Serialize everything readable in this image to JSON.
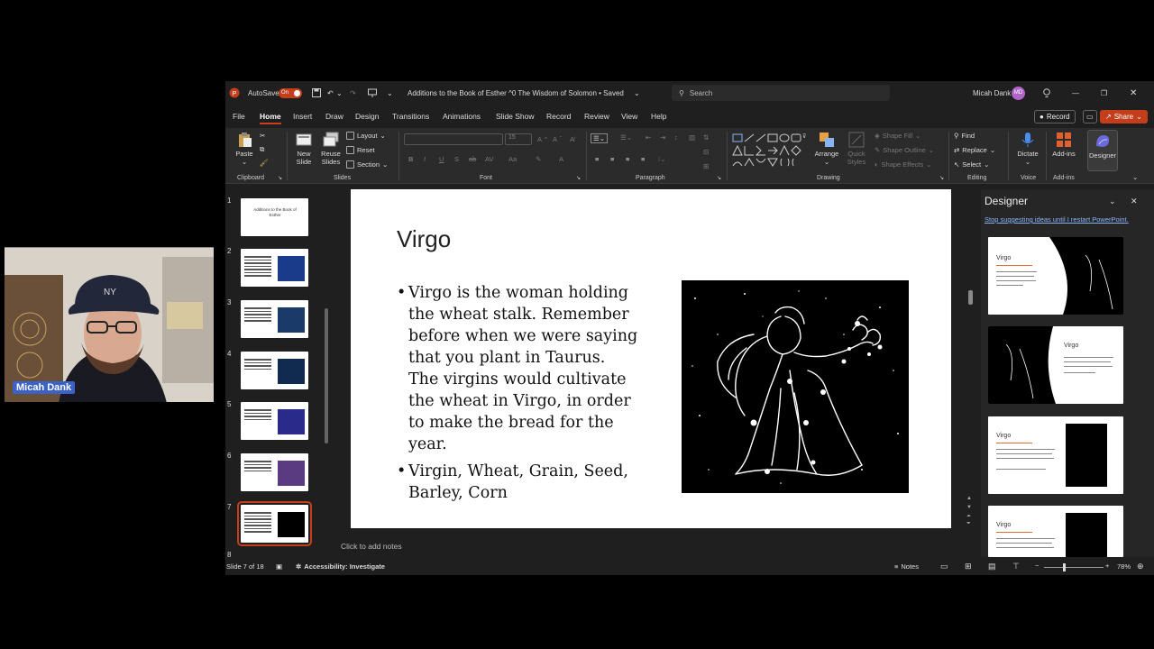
{
  "titlebar": {
    "autosave_label": "AutoSave",
    "autosave_state": "On",
    "doc_title": "Additions to the Book of Esther ^0 The Wisdom of Solomon • Saved",
    "search_placeholder": "Search",
    "user_name": "Micah Dank",
    "user_initials": "MD"
  },
  "menu": {
    "items": [
      "File",
      "Home",
      "Insert",
      "Draw",
      "Design",
      "Transitions",
      "Animations",
      "Slide Show",
      "Record",
      "Review",
      "View",
      "Help"
    ],
    "active": "Home",
    "record_button": "Record",
    "share_button": "Share"
  },
  "ribbon": {
    "clipboard": {
      "paste": "Paste",
      "label": "Clipboard"
    },
    "slides": {
      "new_slide": "New Slide",
      "reuse_slides": "Reuse Slides",
      "layout": "Layout",
      "reset": "Reset",
      "section": "Section",
      "label": "Slides"
    },
    "font": {
      "size": "15",
      "label": "Font"
    },
    "paragraph": {
      "label": "Paragraph"
    },
    "drawing": {
      "arrange": "Arrange",
      "quick_styles": "Quick Styles",
      "shape_fill": "Shape Fill",
      "shape_outline": "Shape Outline",
      "shape_effects": "Shape Effects",
      "label": "Drawing"
    },
    "editing": {
      "find": "Find",
      "replace": "Replace",
      "select": "Select",
      "label": "Editing"
    },
    "voice": {
      "dictate": "Dictate",
      "label": "Voice"
    },
    "addins": {
      "addins": "Add-ins",
      "label": "Add-ins"
    },
    "designer": {
      "designer": "Designer"
    }
  },
  "thumbnails": {
    "numbers": [
      "1",
      "2",
      "3",
      "4",
      "5",
      "6",
      "7",
      "8"
    ],
    "slide1_text": "Additions to the Book of Esther",
    "selected": "7"
  },
  "slide": {
    "title": "Virgo",
    "bullet1": "Virgo is the woman holding the wheat stalk. Remember before when we were saying that you plant in Taurus. The virgins would cultivate the wheat in Virgo, in order to make the bread for the year.",
    "bullet2": "Virgin, Wheat, Grain, Seed, Barley, Corn"
  },
  "notes_placeholder": "Click to add notes",
  "designer": {
    "title": "Designer",
    "link": "Stop suggesting ideas until I restart PowerPoint.",
    "card_title": "Virgo"
  },
  "status": {
    "slide_counter": "Slide 7 of 18",
    "accessibility": "Accessibility: Investigate",
    "notes": "Notes",
    "zoom": "78%"
  },
  "webcam": {
    "name": "Micah Dank"
  },
  "colors": {
    "accent": "#c43e1c",
    "ribbon_bg": "#2b2b2b",
    "app_bg": "#1f1f1f",
    "link": "#8ab4f8",
    "cam_badge": "#3a62c8"
  }
}
